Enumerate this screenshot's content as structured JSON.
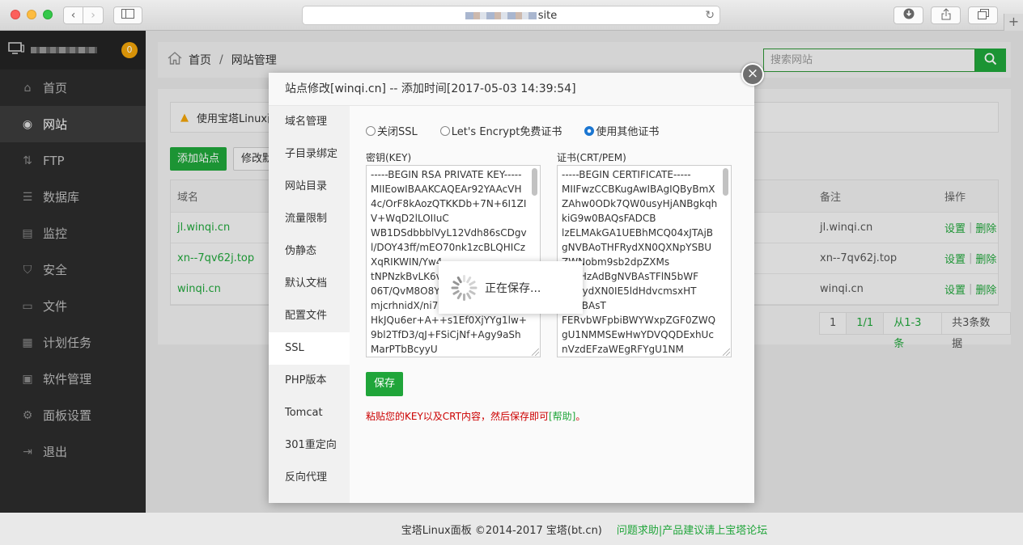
{
  "browser": {
    "url_suffix": "site",
    "icons": {
      "back": "chevron-left-icon",
      "forward": "chevron-right-icon",
      "sidebar": "sidebar-icon",
      "reload": "reload-icon",
      "download": "download-icon",
      "share": "share-icon",
      "tabs": "tabs-icon",
      "new_tab": "plus-icon"
    }
  },
  "sidebar": {
    "badge": "0",
    "items": [
      {
        "label": "首页",
        "icon": "home-icon"
      },
      {
        "label": "网站",
        "icon": "globe-icon",
        "active": true
      },
      {
        "label": "FTP",
        "icon": "ftp-icon"
      },
      {
        "label": "数据库",
        "icon": "database-icon"
      },
      {
        "label": "监控",
        "icon": "monitor-icon"
      },
      {
        "label": "安全",
        "icon": "shield-icon"
      },
      {
        "label": "文件",
        "icon": "folder-icon"
      },
      {
        "label": "计划任务",
        "icon": "calendar-icon"
      },
      {
        "label": "软件管理",
        "icon": "apps-icon"
      },
      {
        "label": "面板设置",
        "icon": "gear-icon"
      },
      {
        "label": "退出",
        "icon": "logout-icon"
      }
    ]
  },
  "header": {
    "home": "首页",
    "separator": "/",
    "current": "网站管理",
    "search_placeholder": "搜索网站"
  },
  "main": {
    "notice": "使用宝塔Linux面",
    "add_site": "添加站点",
    "modify_default": "修改默认",
    "table": {
      "headers": {
        "name": "域名",
        "note": "备注",
        "op": "操作"
      },
      "rows": [
        {
          "name": "jl.winqi.cn",
          "note": "jl.winqi.cn",
          "set": "设置",
          "del": "删除"
        },
        {
          "name": "xn--7qv62j.top",
          "note": "xn--7qv62j.top",
          "set": "设置",
          "del": "删除"
        },
        {
          "name": "winqi.cn",
          "note": "winqi.cn",
          "set": "设置",
          "del": "删除"
        }
      ]
    },
    "pager": {
      "first": "1",
      "current": "1/1",
      "range": "从1-3条",
      "total": "共3条数据"
    }
  },
  "modal": {
    "title": "站点修改[winqi.cn] -- 添加时间[2017-05-03 14:39:54]",
    "close": "×",
    "tabs": [
      "域名管理",
      "子目录绑定",
      "网站目录",
      "流量限制",
      "伪静态",
      "默认文档",
      "配置文件",
      "SSL",
      "PHP版本",
      "Tomcat",
      "301重定向",
      "反向代理"
    ],
    "active_tab": "SSL",
    "ssl_options": [
      {
        "label": "关闭SSL",
        "checked": false
      },
      {
        "label": "Let's Encrypt免费证书",
        "checked": false
      },
      {
        "label": "使用其他证书",
        "checked": true
      }
    ],
    "key_label": "密钥(KEY)",
    "crt_label": "证书(CRT/PEM)",
    "key_text": "-----BEGIN RSA PRIVATE KEY-----\nMIIEowIBAAKCAQEAr92YAAcVH4c/OrF8kAozQTKKDb+7N+6I1ZIV+WqD2lLOIIuC\nWB1DSdbbblVyL12Vdh86sCDgvl/DOY43ff/mEO70nk1zcBLQHICzXqRIKWIN/Yw4\ntNPNzkBvLK6v\n06T/QvM8O8Y\nmjcrhnidX/ni7\nHkJQu6er+A++s1Ef0XjYYg1lw+9bl2TfD3/qJ+FSiCjNf+Agy9aShMarPTbBcyyU",
    "crt_text": "-----BEGIN CERTIFICATE-----\nMIIFwzCCBKugAwIBAgIQByBmXZAhw0ODk7QW0usyHjANBgkqhkiG9w0BAQsFADCB\nlzELMAkGA1UEBhMCQ04xJTAjBgNVBAoTHFRydXN0QXNpYSBUZWNobm9sb2dpZXMs\ny4xHzAdBgNVBAsTFlN5bWF\n/jIFRydXN0IE5ldHdvcmsxHT\ngNVBAsT\nFERvbWFpbiBWYWxpZGF0ZWQgU1NMMSEwHwYDVQQDExhUcnVzdEFzaWEgRFYgU1NM",
    "save": "保存",
    "hint_text": "粘贴您的KEY以及CRT内容，然后保存即可",
    "hint_link": "[帮助]",
    "hint_end": "。"
  },
  "loading": {
    "text": "正在保存..."
  },
  "footer": {
    "copyright": "宝塔Linux面板 ©2014-2017 宝塔(bt.cn)",
    "link": "问题求助|产品建议请上宝塔论坛"
  }
}
